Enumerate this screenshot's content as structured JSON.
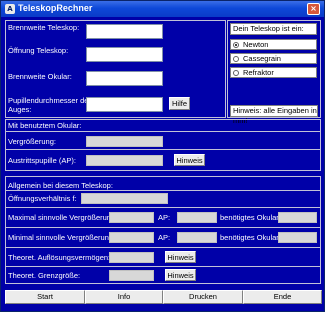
{
  "window": {
    "title": "TeleskopRechner",
    "icon": "telescope-app-icon",
    "close_glyph": "×"
  },
  "inputs": {
    "brennweite_teleskop": {
      "label": "Brennweite Teleskop:",
      "value": ""
    },
    "oeffnung_teleskop": {
      "label": "Öffnung Teleskop:",
      "value": ""
    },
    "brennweite_okular": {
      "label": "Brennweite Okular:",
      "value": ""
    },
    "pupillendurchmesser": {
      "label_line1": "Pupillendurchmesser des",
      "label_line2": "Auges:",
      "value": ""
    },
    "hilfe_button": "Hilfe"
  },
  "teleskop_type": {
    "title": "Dein Teleskop ist ein:",
    "options": [
      {
        "label": "Newton",
        "selected": true
      },
      {
        "label": "Cassegrain",
        "selected": false
      },
      {
        "label": "Refraktor",
        "selected": false
      }
    ],
    "hint": "Hinweis: alle Eingaben in mm!"
  },
  "okular_section": {
    "title": "Mit benutztem Okular:",
    "vergroesserung_label": "Vergrößerung:",
    "austrittspupille_label": "Austrittspupille (AP):",
    "hinweis_button": "Hinweis"
  },
  "allgemein_section": {
    "title": "Allgemein bei diesem Teleskop:",
    "oeffnungsverhaeltnis_label": "Öffnungsverhältnis f:",
    "max_vergroesserung_label": "Maximal sinnvolle Vergrößerung:",
    "min_vergroesserung_label": "Minimal sinnvolle Vergrößerung:",
    "ap_label": "AP:",
    "benoetigtes_okular_label": "benötigtes Okular:",
    "aufloesung_label": "Theoret. Auflösungsvermögen:",
    "grenzgroesse_label": "Theoret. Grenzgröße:",
    "hinweis_button": "Hinweis"
  },
  "bottom_buttons": [
    "Start",
    "Info",
    "Drucken",
    "Ende"
  ]
}
